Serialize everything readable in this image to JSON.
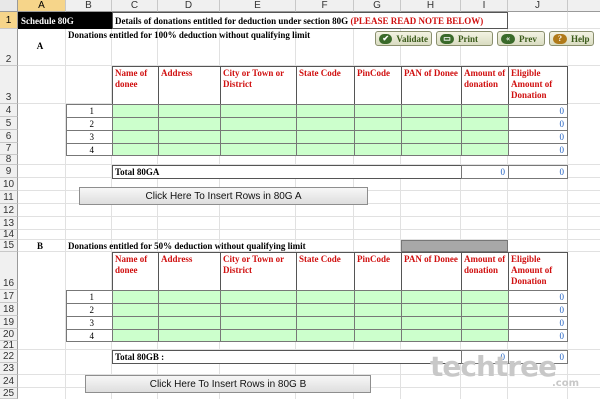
{
  "columns": [
    "A",
    "B",
    "C",
    "D",
    "E",
    "F",
    "G",
    "H",
    "I",
    "J"
  ],
  "rows": [
    "1",
    "2",
    "3",
    "4",
    "5",
    "6",
    "7",
    "8",
    "9",
    "10",
    "11",
    "12",
    "13",
    "14",
    "15",
    "16",
    "17",
    "18",
    "19",
    "20",
    "21",
    "22",
    "23",
    "24",
    "25"
  ],
  "title": {
    "schedule": "Schedule 80G",
    "details": "Details of donations entitled for deduction under section 80G",
    "note": "(PLEASE READ NOTE BELOW)"
  },
  "toolbar": {
    "validate": "Validate",
    "print": "Print",
    "prev": "Prev",
    "help": "Help"
  },
  "section_a": {
    "label": "A",
    "heading": "Donations entitled for 100% deduction without qualifying limit",
    "headers": [
      "Name of donee",
      "Address",
      "City or Town or District",
      "State Code",
      "PinCode",
      "PAN of Donee",
      "Amount of donation",
      "Eligible Amount of Donation"
    ],
    "row_numbers": [
      "1",
      "2",
      "3",
      "4"
    ],
    "eligible_values": [
      "0",
      "0",
      "0",
      "0"
    ],
    "total_label": "Total  80GA",
    "total_amount": "0",
    "total_eligible": "0",
    "insert_button": "Click Here To Insert  Rows in 80G A"
  },
  "section_b": {
    "label": "B",
    "heading": "Donations entitled for 50% deduction without qualifying limit",
    "headers": [
      "Name of donee",
      "Address",
      "City or Town or District",
      "State Code",
      "PinCode",
      "PAN of Donee",
      "Amount of donation",
      "Eligible Amount of Donation"
    ],
    "row_numbers": [
      "1",
      "2",
      "3",
      "4"
    ],
    "eligible_values": [
      "0",
      "0",
      "0",
      "0"
    ],
    "total_label": "Total  80GB :",
    "total_amount": "0",
    "total_eligible": "0",
    "insert_button": "Click Here To Insert  Rows in 80G B"
  },
  "watermark": {
    "brand": "techtree",
    "suffix": ".com"
  },
  "colors": {
    "input_fill": "#ccffcc",
    "header_text": "#d01010",
    "value_text": "#1f5fc0",
    "selected_header": "#f6d58a"
  }
}
